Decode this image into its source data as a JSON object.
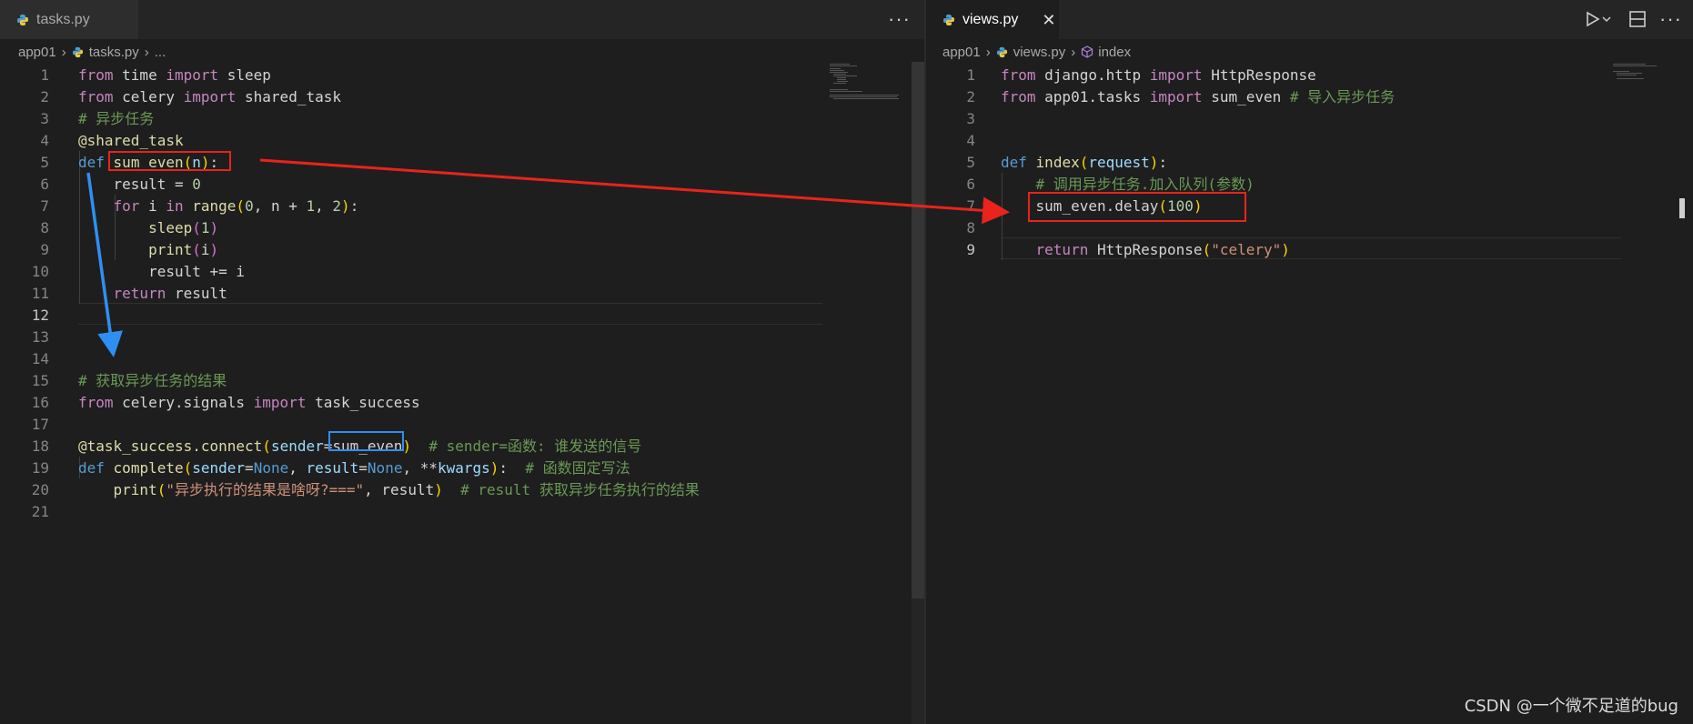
{
  "left": {
    "tab": {
      "label": "tasks.py"
    },
    "breadcrumb": {
      "folder": "app01",
      "file": "tasks.py",
      "more": "..."
    },
    "more_actions": "···",
    "lines": [
      {
        "n": "1",
        "parts": [
          {
            "t": "from",
            "c": "kw"
          },
          {
            "t": " time ",
            "c": "plain"
          },
          {
            "t": "import",
            "c": "kw"
          },
          {
            "t": " sleep",
            "c": "plain"
          }
        ]
      },
      {
        "n": "2",
        "parts": [
          {
            "t": "from",
            "c": "kw"
          },
          {
            "t": " celery ",
            "c": "plain"
          },
          {
            "t": "import",
            "c": "kw"
          },
          {
            "t": " shared_task",
            "c": "plain"
          }
        ]
      },
      {
        "n": "3",
        "parts": [
          {
            "t": "# 异步任务",
            "c": "com"
          }
        ]
      },
      {
        "n": "4",
        "parts": [
          {
            "t": "@shared_task",
            "c": "dec"
          }
        ]
      },
      {
        "n": "5",
        "parts": [
          {
            "t": "def",
            "c": "kw2"
          },
          {
            "t": " ",
            "c": "plain"
          },
          {
            "t": "sum_even",
            "c": "fn"
          },
          {
            "t": "(",
            "c": "p1"
          },
          {
            "t": "n",
            "c": "var"
          },
          {
            "t": ")",
            "c": "p1"
          },
          {
            "t": ":",
            "c": "plain"
          }
        ]
      },
      {
        "n": "6",
        "parts": [
          {
            "t": "    result = ",
            "c": "plain"
          },
          {
            "t": "0",
            "c": "num"
          }
        ]
      },
      {
        "n": "7",
        "parts": [
          {
            "t": "    ",
            "c": "plain"
          },
          {
            "t": "for",
            "c": "kw"
          },
          {
            "t": " i ",
            "c": "plain"
          },
          {
            "t": "in",
            "c": "kw"
          },
          {
            "t": " ",
            "c": "plain"
          },
          {
            "t": "range",
            "c": "fn"
          },
          {
            "t": "(",
            "c": "p1"
          },
          {
            "t": "0",
            "c": "num"
          },
          {
            "t": ", n + ",
            "c": "plain"
          },
          {
            "t": "1",
            "c": "num"
          },
          {
            "t": ", ",
            "c": "plain"
          },
          {
            "t": "2",
            "c": "num"
          },
          {
            "t": ")",
            "c": "p1"
          },
          {
            "t": ":",
            "c": "plain"
          }
        ]
      },
      {
        "n": "8",
        "parts": [
          {
            "t": "        ",
            "c": "plain"
          },
          {
            "t": "sleep",
            "c": "fn"
          },
          {
            "t": "(",
            "c": "p2"
          },
          {
            "t": "1",
            "c": "num"
          },
          {
            "t": ")",
            "c": "p2"
          }
        ]
      },
      {
        "n": "9",
        "parts": [
          {
            "t": "        ",
            "c": "plain"
          },
          {
            "t": "print",
            "c": "fn"
          },
          {
            "t": "(",
            "c": "p2"
          },
          {
            "t": "i",
            "c": "plain"
          },
          {
            "t": ")",
            "c": "p2"
          }
        ]
      },
      {
        "n": "10",
        "parts": [
          {
            "t": "        result += i",
            "c": "plain"
          }
        ]
      },
      {
        "n": "11",
        "parts": [
          {
            "t": "    ",
            "c": "plain"
          },
          {
            "t": "return",
            "c": "kw"
          },
          {
            "t": " result",
            "c": "plain"
          }
        ]
      },
      {
        "n": "12",
        "parts": []
      },
      {
        "n": "13",
        "parts": []
      },
      {
        "n": "14",
        "parts": []
      },
      {
        "n": "15",
        "parts": [
          {
            "t": "# 获取异步任务的结果",
            "c": "com"
          }
        ]
      },
      {
        "n": "16",
        "parts": [
          {
            "t": "from",
            "c": "kw"
          },
          {
            "t": " celery.signals ",
            "c": "plain"
          },
          {
            "t": "import",
            "c": "kw"
          },
          {
            "t": " task_success",
            "c": "plain"
          }
        ]
      },
      {
        "n": "17",
        "parts": []
      },
      {
        "n": "18",
        "parts": [
          {
            "t": "@task_success.connect",
            "c": "dec"
          },
          {
            "t": "(",
            "c": "p1"
          },
          {
            "t": "sender",
            "c": "var"
          },
          {
            "t": "=",
            "c": "plain"
          },
          {
            "t": "sum_even",
            "c": "plain"
          },
          {
            "t": ")",
            "c": "p1"
          },
          {
            "t": "  # sender=函数: 谁发送的信号",
            "c": "com"
          }
        ]
      },
      {
        "n": "19",
        "parts": [
          {
            "t": "def",
            "c": "kw2"
          },
          {
            "t": " ",
            "c": "plain"
          },
          {
            "t": "complete",
            "c": "fn"
          },
          {
            "t": "(",
            "c": "p1"
          },
          {
            "t": "sender",
            "c": "var"
          },
          {
            "t": "=",
            "c": "plain"
          },
          {
            "t": "None",
            "c": "cn"
          },
          {
            "t": ", ",
            "c": "plain"
          },
          {
            "t": "result",
            "c": "var"
          },
          {
            "t": "=",
            "c": "plain"
          },
          {
            "t": "None",
            "c": "cn"
          },
          {
            "t": ", **",
            "c": "plain"
          },
          {
            "t": "kwargs",
            "c": "var"
          },
          {
            "t": ")",
            "c": "p1"
          },
          {
            "t": ":",
            "c": "plain"
          },
          {
            "t": "  # 函数固定写法",
            "c": "com"
          }
        ]
      },
      {
        "n": "20",
        "parts": [
          {
            "t": "    ",
            "c": "plain"
          },
          {
            "t": "print",
            "c": "fn"
          },
          {
            "t": "(",
            "c": "p1"
          },
          {
            "t": "\"异步执行的结果是啥呀?===\"",
            "c": "str"
          },
          {
            "t": ", result",
            "c": "plain"
          },
          {
            "t": ")",
            "c": "p1"
          },
          {
            "t": "  # result 获取异步任务执行的结果",
            "c": "com"
          }
        ]
      },
      {
        "n": "21",
        "parts": []
      }
    ]
  },
  "right": {
    "tab": {
      "label": "views.py",
      "close": "✕"
    },
    "breadcrumb": {
      "folder": "app01",
      "file": "views.py",
      "symbol": "index"
    },
    "lines": [
      {
        "n": "1",
        "parts": [
          {
            "t": "from",
            "c": "kw"
          },
          {
            "t": " django.http ",
            "c": "plain"
          },
          {
            "t": "import",
            "c": "kw"
          },
          {
            "t": " HttpResponse",
            "c": "plain"
          }
        ]
      },
      {
        "n": "2",
        "parts": [
          {
            "t": "from",
            "c": "kw"
          },
          {
            "t": " app01.tasks ",
            "c": "plain"
          },
          {
            "t": "import",
            "c": "kw"
          },
          {
            "t": " sum_even ",
            "c": "plain"
          },
          {
            "t": "# 导入异步任务",
            "c": "com"
          }
        ]
      },
      {
        "n": "3",
        "parts": []
      },
      {
        "n": "4",
        "parts": []
      },
      {
        "n": "5",
        "parts": [
          {
            "t": "def",
            "c": "kw2"
          },
          {
            "t": " ",
            "c": "plain"
          },
          {
            "t": "index",
            "c": "fn"
          },
          {
            "t": "(",
            "c": "p1"
          },
          {
            "t": "request",
            "c": "var"
          },
          {
            "t": ")",
            "c": "p1"
          },
          {
            "t": ":",
            "c": "plain"
          }
        ]
      },
      {
        "n": "6",
        "parts": [
          {
            "t": "    # 调用异步任务.加入队列(参数)",
            "c": "com"
          }
        ]
      },
      {
        "n": "7",
        "parts": [
          {
            "t": "    sum_even.delay",
            "c": "plain"
          },
          {
            "t": "(",
            "c": "p1"
          },
          {
            "t": "100",
            "c": "num"
          },
          {
            "t": ")",
            "c": "p1"
          }
        ]
      },
      {
        "n": "8",
        "parts": []
      },
      {
        "n": "9",
        "parts": [
          {
            "t": "    ",
            "c": "plain"
          },
          {
            "t": "return",
            "c": "kw"
          },
          {
            "t": " HttpResponse",
            "c": "plain"
          },
          {
            "t": "(",
            "c": "p1"
          },
          {
            "t": "\"celery\"",
            "c": "str"
          },
          {
            "t": ")",
            "c": "p1"
          }
        ]
      }
    ]
  },
  "watermark": "CSDN @一个微不足道的bug",
  "colors": {
    "accent_red": "#e8241b",
    "accent_blue": "#2f8ff0",
    "editor_bg": "#1e1e1e"
  }
}
